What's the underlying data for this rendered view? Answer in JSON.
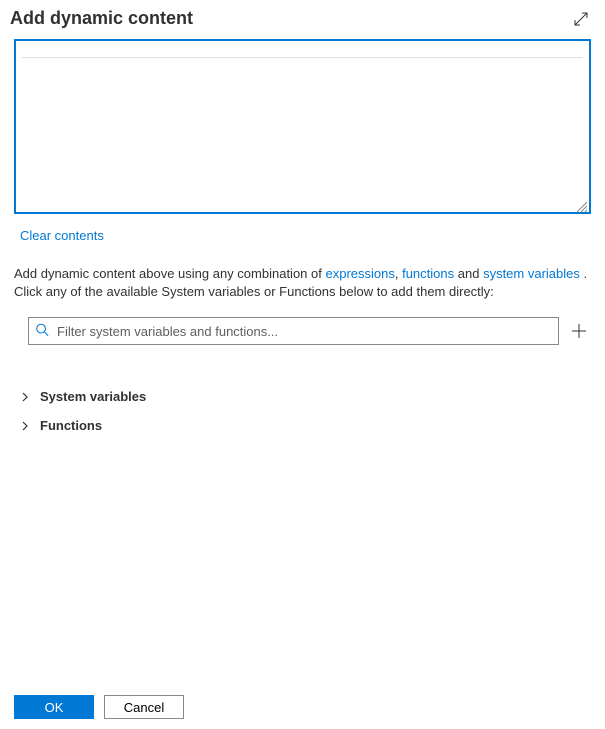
{
  "header": {
    "title": "Add dynamic content"
  },
  "editor": {
    "clear_label": "Clear contents"
  },
  "help": {
    "prefix": "Add dynamic content above using any combination of ",
    "link_expressions": "expressions",
    "comma": ", ",
    "link_functions": "functions",
    "and": " and ",
    "link_system_variables": "system variables",
    "period": " .",
    "line2": "Click any of the available System variables or Functions below to add them directly:"
  },
  "filter": {
    "placeholder": "Filter system variables and functions..."
  },
  "tree": {
    "system_variables_label": "System variables",
    "functions_label": "Functions"
  },
  "footer": {
    "ok_label": "OK",
    "cancel_label": "Cancel"
  }
}
